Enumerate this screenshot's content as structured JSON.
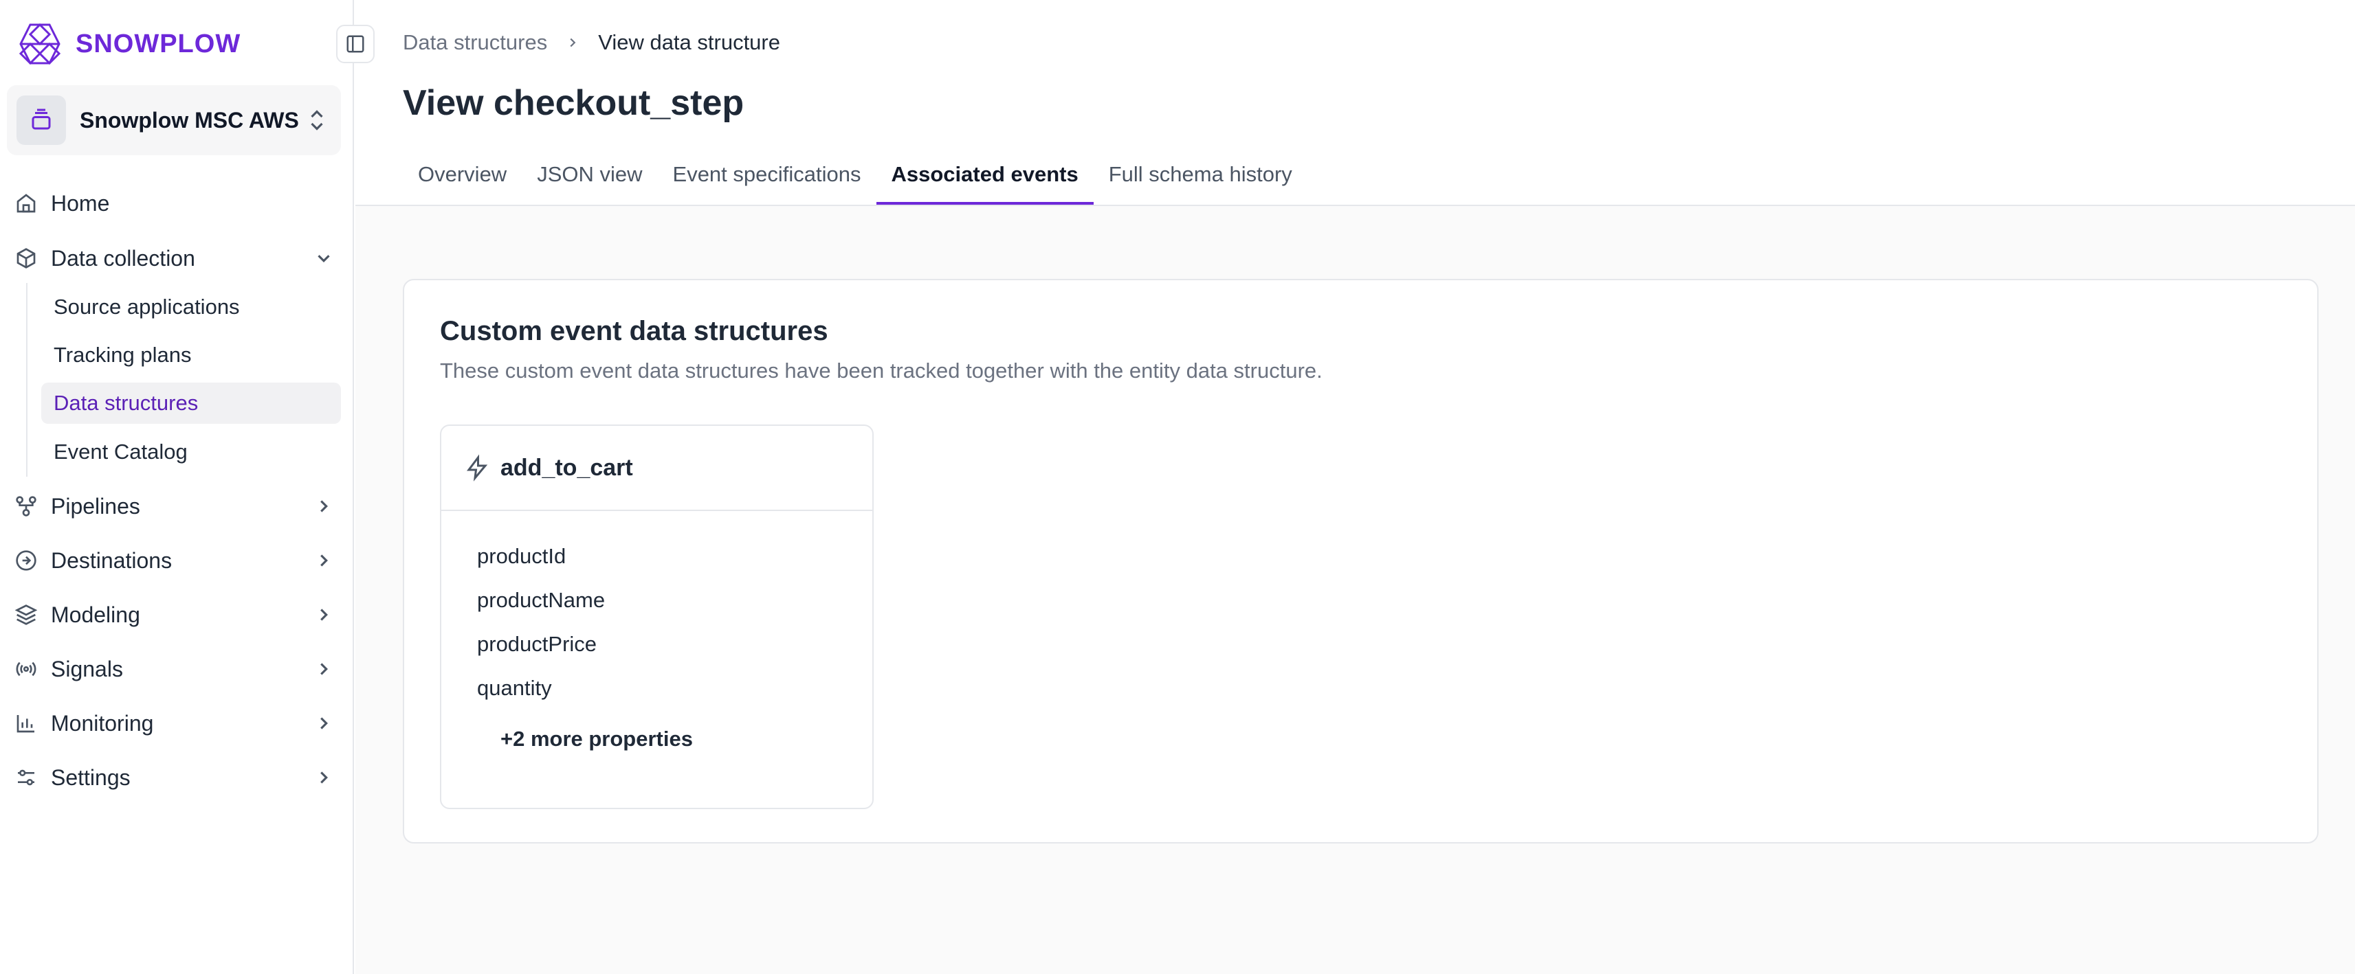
{
  "brand": {
    "name": "SNOWPLOW",
    "color": "#6d28d9"
  },
  "org": {
    "name": "Snowplow MSC AWS"
  },
  "nav": {
    "home": "Home",
    "data_collection": "Data collection",
    "sub_items": [
      "Source applications",
      "Tracking plans",
      "Data structures",
      "Event Catalog"
    ],
    "pipelines": "Pipelines",
    "destinations": "Destinations",
    "modeling": "Modeling",
    "signals": "Signals",
    "monitoring": "Monitoring",
    "settings": "Settings"
  },
  "breadcrumb": {
    "parent": "Data structures",
    "current": "View data structure"
  },
  "page": {
    "title": "View checkout_step"
  },
  "tabs": [
    "Overview",
    "JSON view",
    "Event specifications",
    "Associated events",
    "Full schema history"
  ],
  "section": {
    "title": "Custom event data structures",
    "description": "These custom event data structures have been tracked together with the entity data structure."
  },
  "event": {
    "name": "add_to_cart",
    "properties": [
      "productId",
      "productName",
      "productPrice",
      "quantity"
    ],
    "more": "+2 more properties"
  },
  "icons": [
    "snowplow-logo-icon",
    "sidebar-toggle-icon",
    "stack-icon",
    "chevrons-up-down-icon",
    "home-icon",
    "box-icon",
    "chevron-down-icon",
    "pipeline-icon",
    "arrow-circle-icon",
    "layers-icon",
    "signal-icon",
    "bar-chart-icon",
    "sliders-icon",
    "chevron-right-icon",
    "lightning-icon"
  ]
}
